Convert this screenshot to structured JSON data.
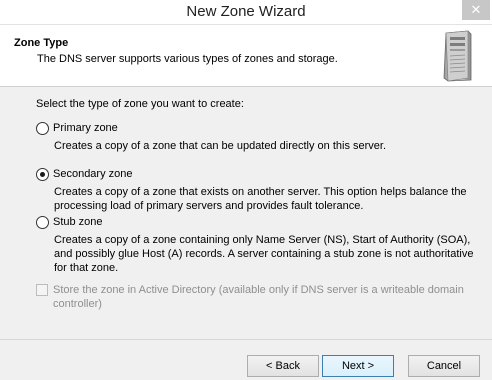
{
  "window": {
    "title": "New Zone Wizard",
    "close_glyph": "✕"
  },
  "header": {
    "title": "Zone Type",
    "subtitle": "The DNS server supports various types of zones and storage.",
    "icon": "server-icon"
  },
  "content": {
    "prompt": "Select the type of zone you want to create:",
    "options": [
      {
        "label": "Primary zone",
        "description": "Creates a copy of a zone that can be updated directly on this server.",
        "selected": false
      },
      {
        "label": "Secondary zone",
        "description": "Creates a copy of a zone that exists on another server. This option helps balance the processing load of primary servers and provides fault tolerance.",
        "selected": true
      },
      {
        "label": "Stub zone",
        "description": "Creates a copy of a zone containing only Name Server (NS), Start of Authority (SOA), and possibly glue Host (A) records. A server containing a stub zone is not authoritative for that zone.",
        "selected": false
      }
    ],
    "ad_checkbox": {
      "label": "Store the zone in Active Directory (available only if DNS server is a writeable domain controller)",
      "checked": false,
      "enabled": false
    }
  },
  "buttons": {
    "back": "< Back",
    "next": "Next >",
    "cancel": "Cancel"
  }
}
